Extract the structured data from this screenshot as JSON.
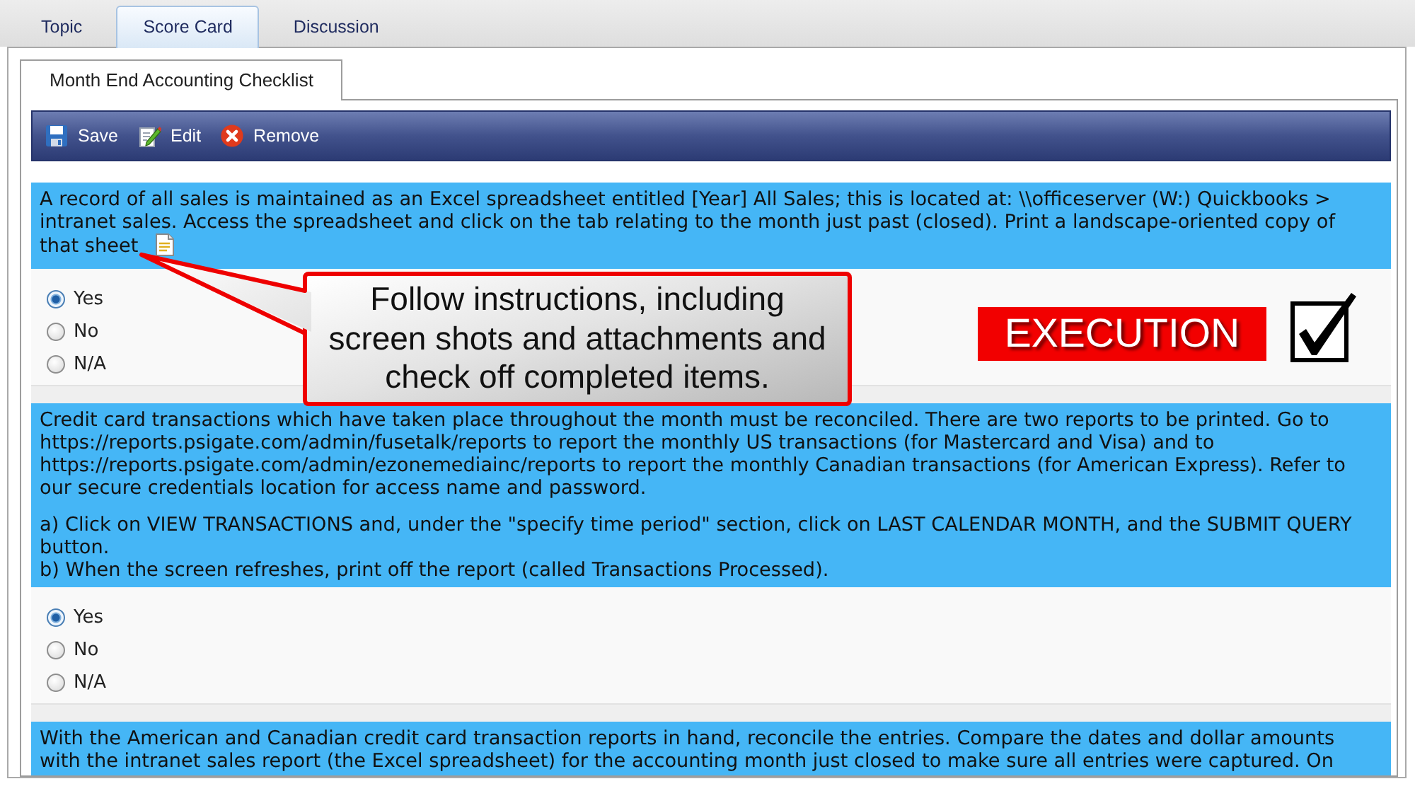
{
  "tabs": [
    {
      "label": "Topic",
      "selected": false
    },
    {
      "label": "Score Card",
      "selected": true
    },
    {
      "label": "Discussion",
      "selected": false
    }
  ],
  "subtabs": [
    {
      "label": "Month End Accounting Checklist",
      "selected": true
    }
  ],
  "toolbar": [
    {
      "kind": "save",
      "label": "Save"
    },
    {
      "kind": "edit",
      "label": "Edit"
    },
    {
      "kind": "remove",
      "label": "Remove"
    }
  ],
  "questions": [
    {
      "paragraphs": [
        [
          "A record of all sales is maintained as an Excel spreadsheet entitled [Year] All Sales; this is located at: \\\\officeserver (W:) Quickbooks > intranet sales. Access the spreadsheet and click on the tab relating to the month just past (closed). Print a landscape-oriented copy of",
          "that sheet"
        ]
      ],
      "attachment": true,
      "options": [
        {
          "label": "Yes",
          "selected": true
        },
        {
          "label": "No",
          "selected": false
        },
        {
          "label": "N/A",
          "selected": false
        }
      ]
    },
    {
      "paragraphs": [
        [
          "Credit card transactions which have taken place throughout the month must be reconciled. There are two reports to be printed. Go to https://reports.psigate.com/admin/fusetalk/reports to report the monthly US transactions (for Mastercard and Visa) and to https://reports.psigate.com/admin/ezonemediainc/reports to report the monthly Canadian transactions (for American Express). Refer to our secure credentials location for access name and password."
        ],
        [
          "a) Click on VIEW TRANSACTIONS and, under the \"specify time period\" section, click on LAST CALENDAR MONTH, and the SUBMIT QUERY button.",
          "b) When the screen refreshes, print off the report (called Transactions Processed)."
        ]
      ],
      "options": [
        {
          "label": "Yes",
          "selected": true
        },
        {
          "label": "No",
          "selected": false
        },
        {
          "label": "N/A",
          "selected": false
        }
      ]
    },
    {
      "paragraphs": [
        [
          "With the American and Canadian credit card transaction reports in hand, reconcile the entries. Compare the dates and dollar amounts with the intranet sales report (the Excel spreadsheet) for the accounting month just closed to make sure all entries were captured. On"
        ]
      ]
    }
  ],
  "annotation": {
    "callout": "Follow instructions, including screen shots and attachments and check off completed items.",
    "label": "EXECUTION",
    "checked": true
  }
}
